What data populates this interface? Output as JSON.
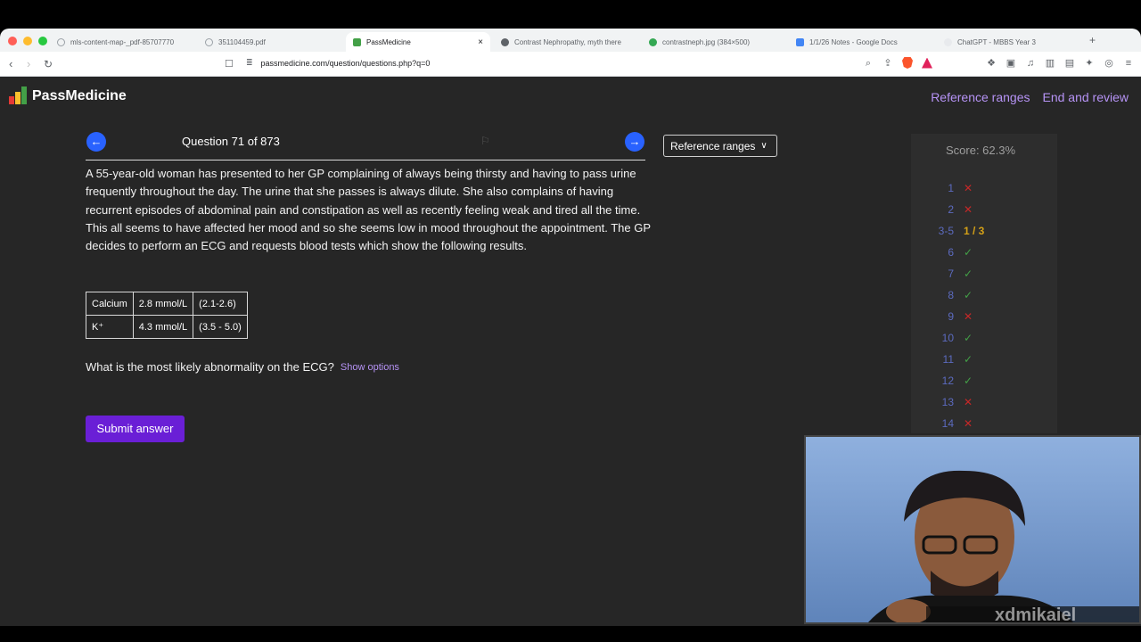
{
  "browser": {
    "tabs": [
      {
        "label": "mls-content-map-_pdf-85707770",
        "icon_color": "#9aa0a6"
      },
      {
        "label": "351104459.pdf",
        "icon_color": "#9aa0a6"
      },
      {
        "label": "PassMedicine",
        "icon_color": "#43a047",
        "active": true
      },
      {
        "label": "Contrast Nephropathy, myth there",
        "icon_color": "#5f6368"
      },
      {
        "label": "contrastneph.jpg (384×500)",
        "icon_color": "#34a853"
      },
      {
        "label": "1/1/26 Notes - Google Docs",
        "icon_color": "#4285f4"
      },
      {
        "label": "ChatGPT - MBBS Year 3",
        "icon_color": "#e8eaed"
      }
    ],
    "close_glyph": "×",
    "new_tab_glyph": "+",
    "url": "passmedicine.com/question/questions.php?q=0"
  },
  "header": {
    "logo_text": "PassMedicine",
    "links": [
      "Reference ranges",
      "End and review"
    ]
  },
  "question": {
    "counter": "Question 71 of 873",
    "reference_button": "Reference ranges",
    "stem": "A 55-year-old woman has presented to her GP complaining of always being thirsty and having to pass urine frequently throughout the day. The urine that she passes is always dilute. She also complains of having recurrent episodes of abdominal pain and constipation as well as recently feeling weak and tired all the time. This all seems to have affected her mood and so she seems low in mood throughout the appointment. The GP decides to perform an ECG and requests blood tests which show the following results.",
    "results": [
      {
        "test": "Calcium",
        "value": "2.8 mmol/L",
        "range": "(2.1-2.6)"
      },
      {
        "test": "K⁺",
        "value": "4.3 mmol/L",
        "range": "(3.5 - 5.0)"
      }
    ],
    "prompt": "What is the most likely abnormality on the ECG?",
    "show_options": "Show options",
    "submit_label": "Submit answer"
  },
  "score": {
    "label": "Score: 62.3%",
    "rows": [
      {
        "num": "1",
        "mark": "✕",
        "status": "wrong"
      },
      {
        "num": "2",
        "mark": "✕",
        "status": "wrong"
      },
      {
        "num": "3-5",
        "mark": "1 / 3",
        "status": "partial"
      },
      {
        "num": "6",
        "mark": "✓",
        "status": "right"
      },
      {
        "num": "7",
        "mark": "✓",
        "status": "right"
      },
      {
        "num": "8",
        "mark": "✓",
        "status": "right"
      },
      {
        "num": "9",
        "mark": "✕",
        "status": "wrong"
      },
      {
        "num": "10",
        "mark": "✓",
        "status": "right"
      },
      {
        "num": "11",
        "mark": "✓",
        "status": "right"
      },
      {
        "num": "12",
        "mark": "✓",
        "status": "right"
      },
      {
        "num": "13",
        "mark": "✕",
        "status": "wrong"
      },
      {
        "num": "14",
        "mark": "✕",
        "status": "wrong"
      }
    ]
  },
  "overlay": {
    "watermark": "xdmikaiel"
  },
  "colors": {
    "accent_purple": "#b693f5",
    "submit_purple": "#6a1fd6",
    "nav_blue": "#2962ff",
    "page_bg": "#262626"
  }
}
